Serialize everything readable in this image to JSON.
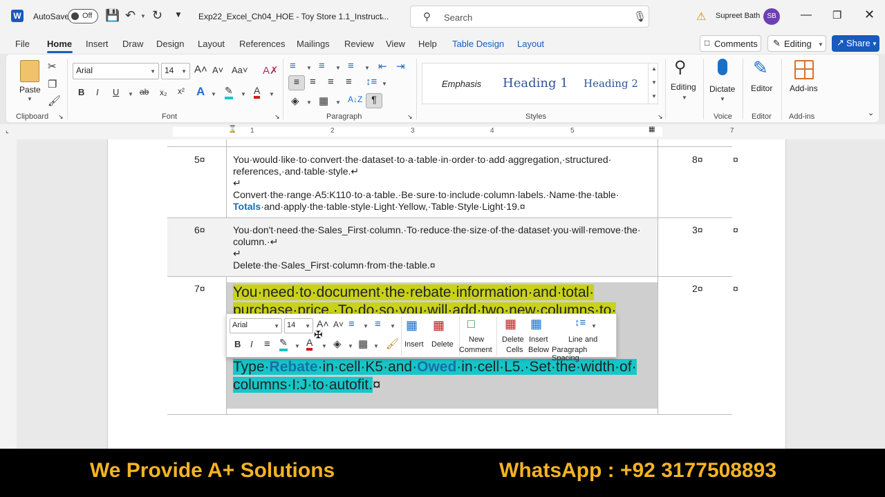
{
  "titlebar": {
    "autosave_label": "AutoSave",
    "autosave_state": "Off",
    "doc_title": "Exp22_Excel_Ch04_HOE - Toy Store 1.1_Instruct...",
    "search_placeholder": "Search",
    "user_name": "Supreet Bath",
    "user_initials": "SB"
  },
  "tabs": [
    "File",
    "Home",
    "Insert",
    "Draw",
    "Design",
    "Layout",
    "References",
    "Mailings",
    "Review",
    "View",
    "Help",
    "Table Design",
    "Layout"
  ],
  "actions": {
    "comments": "Comments",
    "editing": "Editing",
    "share": "Share"
  },
  "ribbon": {
    "clipboard": {
      "paste": "Paste",
      "group": "Clipboard"
    },
    "font": {
      "name": "Arial",
      "size": "14",
      "group": "Font"
    },
    "paragraph": {
      "group": "Paragraph"
    },
    "styles": {
      "s1": "Emphasis",
      "s2": "Heading 1",
      "s3": "Heading 2",
      "group": "Styles"
    },
    "editing": {
      "label": "Editing"
    },
    "voice": {
      "label": "Dictate",
      "group": "Voice"
    },
    "editor": {
      "label": "Editor",
      "group": "Editor"
    },
    "addins": {
      "label": "Add-ins",
      "group": "Add-ins"
    }
  },
  "ruler": {
    "numbers": [
      "1",
      "1",
      "2",
      "3",
      "4",
      "5",
      "6",
      "7"
    ]
  },
  "table": {
    "rows": [
      {
        "num": "5¤",
        "pts": "8¤",
        "end": "¤",
        "l1": "You·would·like·to·convert·the·dataset·to·a·table·in·order·to·add·aggregation,·structured·",
        "l2": "references,·and·table·style.↵",
        "l3": "↵",
        "l4": "Convert·the·range·A5:K110·to·a·table.·Be·sure·to·include·column·labels.·Name·the·table·",
        "l5a": "Totals",
        "l5b": "·and·apply·the·table·style·Light·Yellow,·Table·Style·Light·19.¤"
      },
      {
        "num": "6¤",
        "pts": "3¤",
        "end": "¤",
        "l1": "You·don't·need·the·Sales_First·column.·To·reduce·the·size·of·the·dataset·you·will·remove·the·",
        "l2": "column.·↵",
        "l3": "↵",
        "l4": "Delete·the·Sales_First·column·from·the·table.¤"
      },
      {
        "num": "7¤",
        "pts": "2¤",
        "end": "¤",
        "l1": "You·need·to·document·the·rebate·information·and·total·",
        "l2": "purchase·price.·To·do·so·you·will·add·two·new·columns·to·",
        "l3": "↵",
        "l4a": "Type·",
        "l4b": "Rebate",
        "l4c": "·in·cell·K5·and·",
        "l4d": "Owed",
        "l4e": "·in·cell·L5.·Set·the·width·of·",
        "l5": "columns·I:J·to·autofit.",
        "l5end": "¤"
      }
    ]
  },
  "minitoolbar": {
    "font": "Arial",
    "size": "14",
    "insert": "Insert",
    "delete": "Delete",
    "new_comment": [
      "New",
      "Comment"
    ],
    "delete_cells": [
      "Delete",
      "Cells"
    ],
    "insert_below": [
      "Insert",
      "Below"
    ],
    "spacing": [
      "Line and",
      "Paragraph Spacing"
    ]
  },
  "banner": {
    "left": "We Provide A+ Solutions",
    "right": "WhatsApp : +92 3177508893"
  },
  "colors": {
    "accent": "#185abd",
    "banner_text": "#f5b324",
    "hl_yellow": "#c9d219",
    "hl_cyan": "#17c6c8",
    "bold_blue": "#1a6fa8"
  }
}
